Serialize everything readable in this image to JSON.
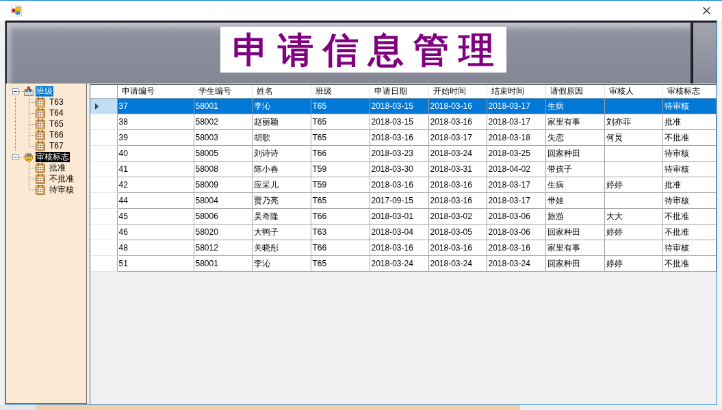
{
  "banner": {
    "title": "申请信息管理"
  },
  "tree": [
    {
      "kind": "classes",
      "label": "班级",
      "expanded": true,
      "selected": true,
      "highlighted": false,
      "children": [
        {
          "label": "T63",
          "selected": false,
          "highlighted": false
        },
        {
          "label": "T64",
          "selected": false,
          "highlighted": false
        },
        {
          "label": "T65",
          "selected": false,
          "highlighted": false
        },
        {
          "label": "T66",
          "selected": false,
          "highlighted": false
        },
        {
          "label": "T67",
          "selected": false,
          "highlighted": false
        }
      ]
    },
    {
      "kind": "review",
      "label": "审核标志",
      "expanded": true,
      "selected": false,
      "highlighted": true,
      "children": [
        {
          "label": "批准",
          "selected": false,
          "highlighted": false
        },
        {
          "label": "不批准",
          "selected": false,
          "highlighted": false
        },
        {
          "label": "待审核",
          "selected": false,
          "highlighted": false
        }
      ]
    }
  ],
  "table": {
    "columns": [
      "申请编号",
      "学生编号",
      "姓名",
      "班级",
      "申请日期",
      "开始时间",
      "结束时间",
      "请假原因",
      "审核人",
      "审核标志"
    ],
    "rows": [
      {
        "selected": true,
        "cells": [
          "37",
          "58001",
          "李沁",
          "T65",
          "2018-03-15",
          "2018-03-16",
          "2018-03-17",
          "生病",
          null,
          "待审核"
        ]
      },
      {
        "selected": false,
        "cells": [
          "38",
          "58002",
          "赵丽颖",
          "T65",
          "2018-03-15",
          "2018-03-16",
          "2018-03-17",
          "家里有事",
          "刘亦菲",
          "批准"
        ]
      },
      {
        "selected": false,
        "cells": [
          "39",
          "58003",
          "胡歌",
          "T65",
          "2018-03-16",
          "2018-03-17",
          "2018-03-18",
          "失恋",
          "何炅",
          "不批准"
        ]
      },
      {
        "selected": false,
        "cells": [
          "40",
          "58005",
          "刘诗诗",
          "T66",
          "2018-03-23",
          "2018-03-24",
          "2018-03-25",
          "回家种田",
          null,
          "待审核"
        ]
      },
      {
        "selected": false,
        "cells": [
          "41",
          "58008",
          "陈小春",
          "T59",
          "2018-03-30",
          "2018-03-31",
          "2018-04-02",
          "带孩子",
          null,
          "待审核"
        ]
      },
      {
        "selected": false,
        "cells": [
          "42",
          "58009",
          "应采儿",
          "T59",
          "2018-03-16",
          "2018-03-16",
          "2018-03-17",
          "生病",
          "婷婷",
          "批准"
        ]
      },
      {
        "selected": false,
        "cells": [
          "44",
          "58004",
          "贾乃亮",
          "T65",
          "2017-09-15",
          "2018-03-16",
          "2018-03-17",
          "带娃",
          null,
          "待审核"
        ]
      },
      {
        "selected": false,
        "cells": [
          "45",
          "58006",
          "吴奇隆",
          "T66",
          "2018-03-01",
          "2018-03-02",
          "2018-03-06",
          "旅游",
          "大大",
          "不批准"
        ]
      },
      {
        "selected": false,
        "cells": [
          "46",
          "58020",
          "大鸭子",
          "T63",
          "2018-03-04",
          "2018-03-05",
          "2018-03-06",
          "回家种田",
          "婷婷",
          "不批准"
        ]
      },
      {
        "selected": false,
        "cells": [
          "48",
          "58012",
          "关晓彤",
          "T66",
          "2018-03-16",
          "2018-03-16",
          "2018-03-16",
          "家里有事",
          null,
          "待审核"
        ]
      },
      {
        "selected": false,
        "cells": [
          "51",
          "58001",
          "李沁",
          "T65",
          "2018-03-24",
          "2018-03-24",
          "2018-03-24",
          "回家种田",
          "婷婷",
          "不批准"
        ]
      }
    ]
  }
}
